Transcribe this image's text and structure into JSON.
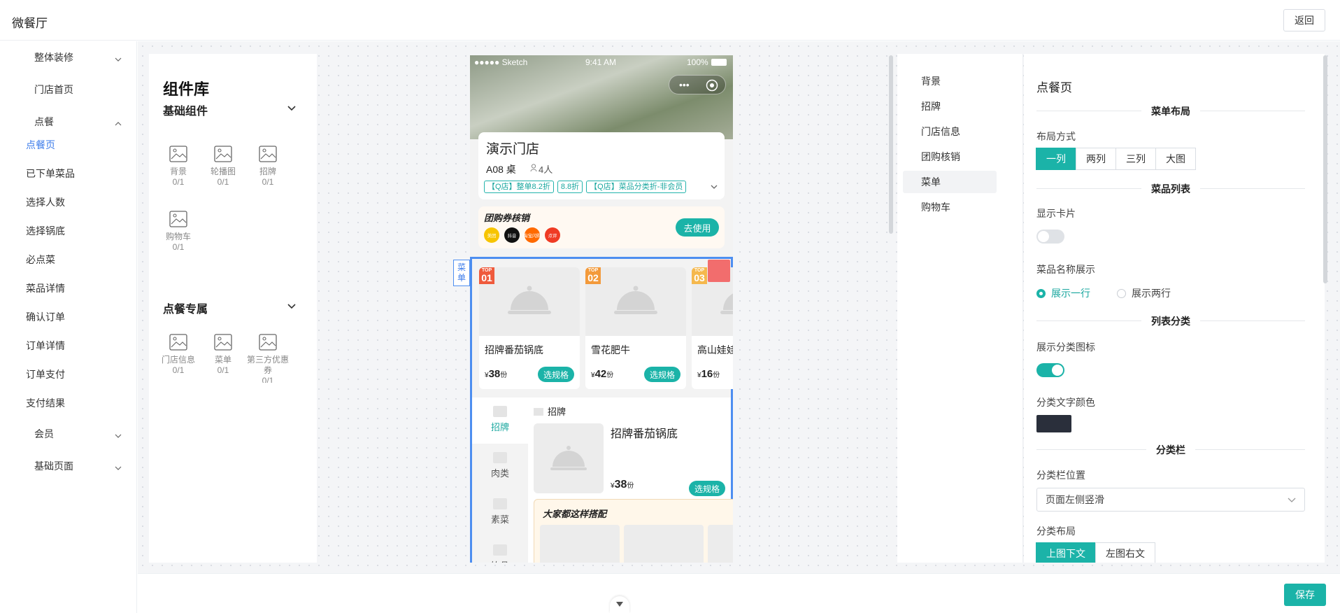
{
  "header": {
    "title": "微餐厅",
    "back_label": "返回"
  },
  "sidebar": {
    "items": [
      {
        "label": "整体装修",
        "indent": true,
        "chevron": "down"
      },
      {
        "label": "门店首页",
        "indent": true
      },
      {
        "label": "点餐",
        "indent": true,
        "chevron": "up"
      },
      {
        "label": "点餐页",
        "active": true
      },
      {
        "label": "已下单菜品"
      },
      {
        "label": "选择人数"
      },
      {
        "label": "选择锅底"
      },
      {
        "label": "必点菜"
      },
      {
        "label": "菜品详情"
      },
      {
        "label": "确认订单"
      },
      {
        "label": "订单详情"
      },
      {
        "label": "订单支付"
      },
      {
        "label": "支付结果"
      },
      {
        "label": "会员",
        "indent": true,
        "chevron": "down"
      },
      {
        "label": "基础页面",
        "indent": true,
        "chevron": "down"
      }
    ]
  },
  "library": {
    "title": "组件库",
    "basic_label": "基础组件",
    "basic": [
      {
        "name": "背景",
        "count": "0/1"
      },
      {
        "name": "轮播图",
        "count": "0/1"
      },
      {
        "name": "招牌",
        "count": "0/1"
      },
      {
        "name": "购物车",
        "count": "0/1"
      }
    ],
    "ordering_label": "点餐专属",
    "ordering": [
      {
        "name": "门店信息",
        "count": "0/1"
      },
      {
        "name": "菜单",
        "count": "0/1"
      },
      {
        "name": "第三方优惠券",
        "count": "0/1"
      }
    ]
  },
  "phone": {
    "status": {
      "carrier": "●●●●● Sketch",
      "time": "9:41 AM",
      "battery": "100%"
    },
    "store_name": "演示门店",
    "table": "A08 桌",
    "people": "4人",
    "tags": [
      "【Q店】整单8.2折",
      "8.8折",
      "【Q店】菜品分类折-非会员"
    ],
    "group": {
      "title": "团购券核销",
      "use_label": "去使用",
      "brands": [
        {
          "name": "美团",
          "color": "#f7c400"
        },
        {
          "name": "抖音",
          "color": "#111111"
        },
        {
          "name": "淘宝闪购",
          "color": "#ff6a00"
        },
        {
          "name": "点评",
          "color": "#ef3b24"
        }
      ]
    },
    "menu_label": "菜单",
    "top_dishes": [
      {
        "rank": "01",
        "name": "招牌番茄锅底",
        "price": "38",
        "unit": "份",
        "rank_color": "#ef5a3c"
      },
      {
        "rank": "02",
        "name": "雪花肥牛",
        "price": "42",
        "unit": "份",
        "rank_color": "#f39a3b"
      },
      {
        "rank": "03",
        "name": "高山娃娃菜",
        "price": "16",
        "unit": "份",
        "rank_color": "#f5b84d"
      }
    ],
    "spec_label": "选规格",
    "top_prefix": "TOP",
    "currency": "¥",
    "categories": [
      "招牌",
      "肉类",
      "素菜",
      "饮品"
    ],
    "section": "招牌",
    "dish": {
      "name": "招牌番茄锅底",
      "price": "38",
      "unit": "份"
    },
    "combo_title": "大家都这样搭配"
  },
  "config_nav": {
    "items": [
      "背景",
      "招牌",
      "门店信息",
      "团购核销",
      "菜单",
      "购物车"
    ],
    "active": "菜单"
  },
  "config": {
    "title": "点餐页",
    "layout_section": "菜单布局",
    "layout_label": "布局方式",
    "layout_options": [
      "一列",
      "两列",
      "三列",
      "大图"
    ],
    "layout_selected": "一列",
    "list_section": "菜品列表",
    "show_card_label": "显示卡片",
    "show_card": false,
    "name_display_label": "菜品名称展示",
    "name_options": [
      "展示一行",
      "展示两行"
    ],
    "name_selected": "展示一行",
    "category_section": "列表分类",
    "show_icon_label": "展示分类图标",
    "show_icon": true,
    "text_color_label": "分类文字颜色",
    "text_color": "#2a2f3b",
    "bar_section": "分类栏",
    "bar_pos_label": "分类栏位置",
    "bar_pos_value": "页面左侧竖滑",
    "bar_layout_label": "分类布局",
    "bar_layout_options": [
      "上图下文",
      "左图右文"
    ],
    "bar_layout_selected": "上图下文"
  },
  "footer": {
    "save_label": "保存"
  },
  "colors": {
    "accent": "#1bb3a8",
    "link": "#3b7bea",
    "selection": "#4d8ef0"
  }
}
